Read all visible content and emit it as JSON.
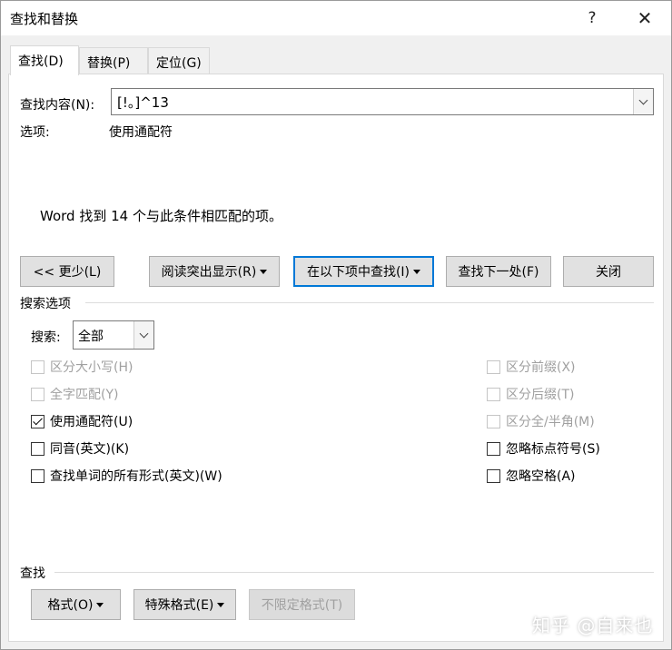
{
  "window": {
    "title": "查找和替换",
    "help_glyph": "?",
    "close_glyph": "✕"
  },
  "tabs": [
    {
      "label": "查找(D)",
      "active": true
    },
    {
      "label": "替换(P)",
      "active": false
    },
    {
      "label": "定位(G)",
      "active": false
    }
  ],
  "find": {
    "label": "查找内容(N):",
    "value": "[!。]^13",
    "options_label": "选项:",
    "options_value": "使用通配符"
  },
  "result_message": "Word 找到 14 个与此条件相匹配的项。",
  "buttons": {
    "less": "<< 更少(L)",
    "reading_highlight": "阅读突出显示(R)",
    "find_in": "在以下项中查找(I)",
    "find_next": "查找下一处(F)",
    "close": "关闭"
  },
  "search_options": {
    "section_label": "搜索选项",
    "search_label": "搜索:",
    "search_value": "全部",
    "left_options": [
      {
        "label": "区分大小写(H)",
        "checked": false,
        "enabled": false
      },
      {
        "label": "全字匹配(Y)",
        "checked": false,
        "enabled": false
      },
      {
        "label": "使用通配符(U)",
        "checked": true,
        "enabled": true
      },
      {
        "label": "同音(英文)(K)",
        "checked": false,
        "enabled": true
      },
      {
        "label": "查找单词的所有形式(英文)(W)",
        "checked": false,
        "enabled": true
      }
    ],
    "right_options": [
      {
        "label": "区分前缀(X)",
        "checked": false,
        "enabled": false
      },
      {
        "label": "区分后缀(T)",
        "checked": false,
        "enabled": false
      },
      {
        "label": "区分全/半角(M)",
        "checked": false,
        "enabled": false
      },
      {
        "label": "忽略标点符号(S)",
        "checked": false,
        "enabled": true
      },
      {
        "label": "忽略空格(A)",
        "checked": false,
        "enabled": true
      }
    ]
  },
  "find_section": {
    "label": "查找",
    "format_button": "格式(O)",
    "special_button": "特殊格式(E)",
    "no_format_button": "不限定格式(T)"
  },
  "watermark": "知乎 @自来也",
  "colors": {
    "focus_border": "#0078d7",
    "disabled_text": "#a0a0a0",
    "dialog_bg": "#f0f0f0"
  }
}
